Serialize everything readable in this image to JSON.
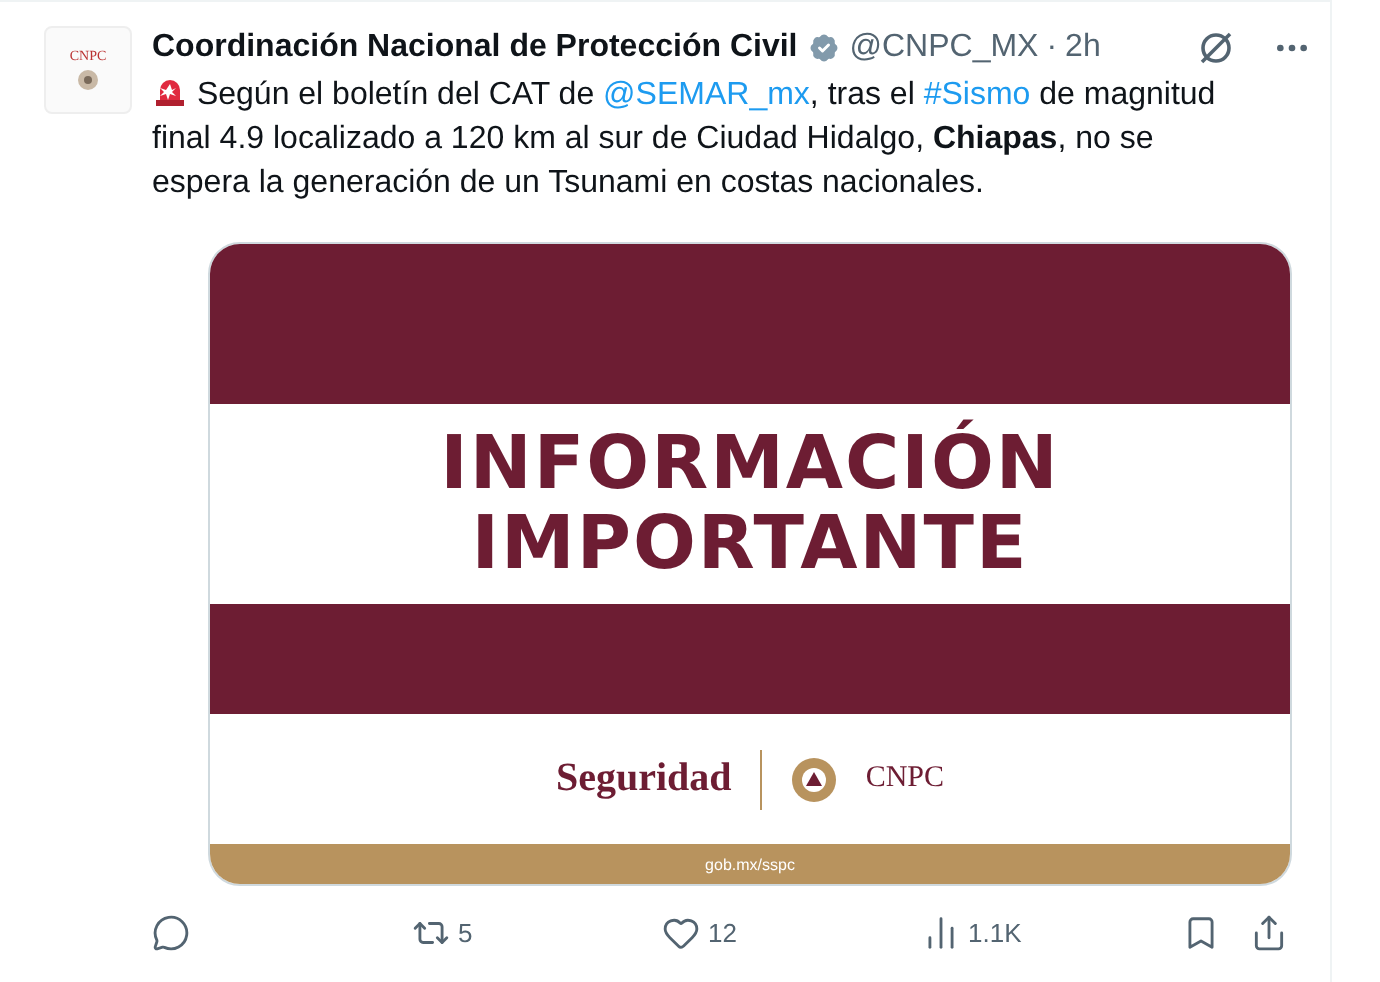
{
  "author": {
    "avatar_text": "CNPC",
    "name": "Coordinación Nacional de Protección Civil",
    "verified": true,
    "handle": "@CNPC_MX",
    "separator": "·",
    "time": "2h"
  },
  "tweet_text": [
    {
      "kind": "text",
      "text": " Según el boletín del CAT de "
    },
    {
      "kind": "link",
      "text": "@SEMAR_mx"
    },
    {
      "kind": "text",
      "text": ", tras el "
    },
    {
      "kind": "link",
      "text": "#Sismo"
    },
    {
      "kind": "text",
      "text": " de magnitud final 4.9 localizado a 120 km al sur de Ciudad Hidalgo, "
    },
    {
      "kind": "bold",
      "text": "Chiapas"
    },
    {
      "kind": "text",
      "text": ", no se espera la generación de un Tsunami en costas nacionales."
    }
  ],
  "media": {
    "headline": [
      "INFORMACIÓN",
      "IMPORTANTE"
    ],
    "left_logo": "Seguridad",
    "right_logo": "CNPC",
    "footer": "gob.mx/sspc"
  },
  "actions": [
    {
      "kind": "reply"
    },
    {
      "kind": "repost",
      "count": "5"
    },
    {
      "kind": "like",
      "count": "12"
    },
    {
      "kind": "views",
      "count": "1.1K"
    },
    {
      "kind": "bookmark"
    },
    {
      "kind": "share"
    }
  ]
}
